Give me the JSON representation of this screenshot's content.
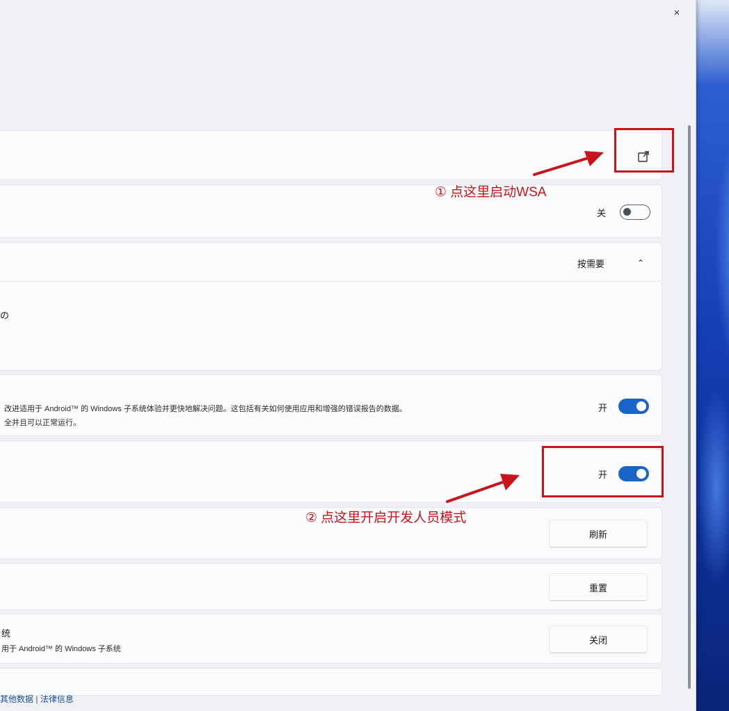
{
  "window": {
    "close_label": "×"
  },
  "top_card": {
    "icon": "external-link-icon"
  },
  "row_toggle_off": {
    "state_label": "关"
  },
  "row_resources": {
    "value_label": "按需要",
    "chevron": "⌃"
  },
  "row_diagnostics": {
    "partial_title": "の",
    "description_line1": "改进适用于 Android™ 的 Windows 子系统体验并更快地解决问题。这包括有关如何使用应用和增强的错误报告的数据。",
    "description_line2": "全并且可以正常运行。",
    "state_label": "开"
  },
  "row_developer_mode": {
    "state_label": "开"
  },
  "row_refresh": {
    "button_label": "刷新"
  },
  "row_reset": {
    "button_label": "重置"
  },
  "row_turn_off": {
    "title": "统",
    "description": "用于 Android™ 的 Windows 子系统",
    "button_label": "关闭"
  },
  "footer": {
    "link1": "其他数据",
    "separator": "|",
    "link2": "法律信息"
  },
  "annotations": {
    "step1": "① 点这里启动WSA",
    "step2": "② 点这里开启开发人员模式"
  },
  "colors": {
    "accent": "#1a64c8",
    "annotation": "#c8141a"
  }
}
